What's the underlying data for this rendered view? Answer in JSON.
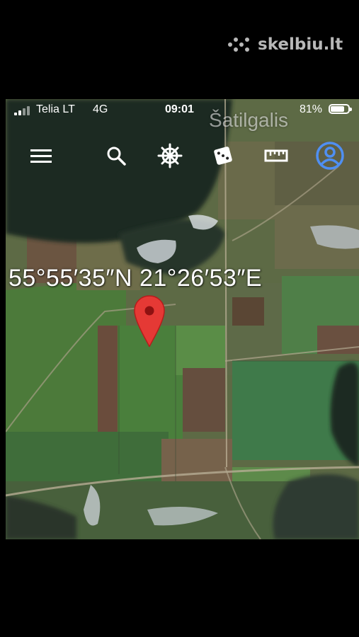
{
  "watermark": {
    "text": "skelbiu.lt"
  },
  "status_bar": {
    "carrier": "Telia LT",
    "network": "4G",
    "time": "09:01",
    "battery": "81%",
    "battery_level": 0.81
  },
  "map": {
    "place_label": "Šatilgalis",
    "coordinates": "55°55′35″N 21°26′53″E"
  },
  "toolbar": {
    "items": [
      {
        "icon": "menu-icon"
      },
      {
        "icon": "search-icon"
      },
      {
        "icon": "voyager-wheel-icon"
      },
      {
        "icon": "dice-icon"
      },
      {
        "icon": "ruler-icon"
      },
      {
        "icon": "account-icon"
      }
    ]
  },
  "colors": {
    "accent": "#4f8ff2",
    "pin": "#e53935",
    "field_green": "#4f7a3c",
    "field_brown": "#6e5a42",
    "forest_dark": "#1f2a24"
  }
}
